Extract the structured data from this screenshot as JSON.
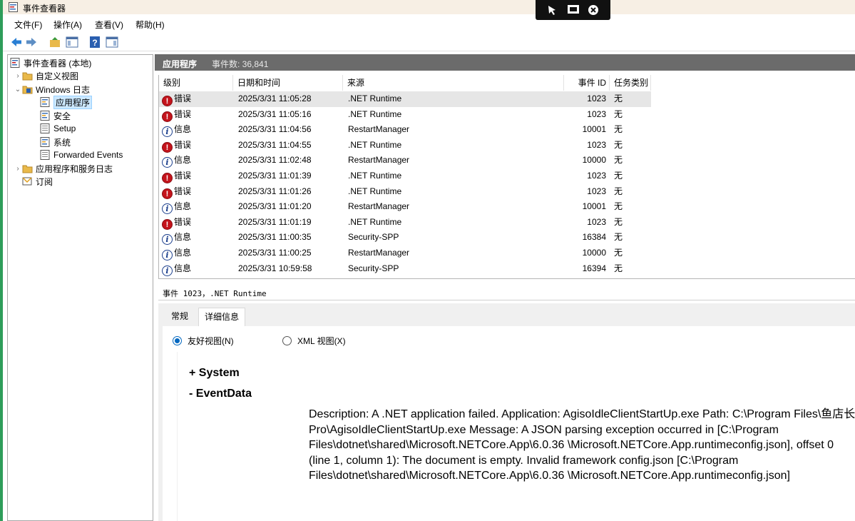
{
  "window": {
    "title": "事件查看器"
  },
  "menu": [
    "文件(F)",
    "操作(A)",
    "查看(V)",
    "帮助(H)"
  ],
  "toolbar": {
    "icons": [
      "back-arrow-icon",
      "forward-arrow-icon",
      "folder-up-icon",
      "show-hide-pane-icon",
      "help-icon",
      "action-pane-icon"
    ]
  },
  "tree": {
    "root": "事件查看器 (本地)",
    "custom_views": "自定义视图",
    "windows_logs": "Windows 日志",
    "application": "应用程序",
    "security": "安全",
    "setup": "Setup",
    "system": "系统",
    "forwarded": "Forwarded Events",
    "app_service_logs": "应用程序和服务日志",
    "subscriptions": "订阅"
  },
  "log_header": {
    "title": "应用程序",
    "count": "事件数: 36,841"
  },
  "columns": [
    "级别",
    "日期和时间",
    "来源",
    "事件 ID",
    "任务类别"
  ],
  "events": [
    {
      "level": "错误",
      "type": "err",
      "date": "2025/3/31 11:05:28",
      "source": ".NET Runtime",
      "id": "1023",
      "category": "无"
    },
    {
      "level": "错误",
      "type": "err",
      "date": "2025/3/31 11:05:16",
      "source": ".NET Runtime",
      "id": "1023",
      "category": "无"
    },
    {
      "level": "信息",
      "type": "info",
      "date": "2025/3/31 11:04:56",
      "source": "RestartManager",
      "id": "10001",
      "category": "无"
    },
    {
      "level": "错误",
      "type": "err",
      "date": "2025/3/31 11:04:55",
      "source": ".NET Runtime",
      "id": "1023",
      "category": "无"
    },
    {
      "level": "信息",
      "type": "info",
      "date": "2025/3/31 11:02:48",
      "source": "RestartManager",
      "id": "10000",
      "category": "无"
    },
    {
      "level": "错误",
      "type": "err",
      "date": "2025/3/31 11:01:39",
      "source": ".NET Runtime",
      "id": "1023",
      "category": "无"
    },
    {
      "level": "错误",
      "type": "err",
      "date": "2025/3/31 11:01:26",
      "source": ".NET Runtime",
      "id": "1023",
      "category": "无"
    },
    {
      "level": "信息",
      "type": "info",
      "date": "2025/3/31 11:01:20",
      "source": "RestartManager",
      "id": "10001",
      "category": "无"
    },
    {
      "level": "错误",
      "type": "err",
      "date": "2025/3/31 11:01:19",
      "source": ".NET Runtime",
      "id": "1023",
      "category": "无"
    },
    {
      "level": "信息",
      "type": "info",
      "date": "2025/3/31 11:00:35",
      "source": "Security-SPP",
      "id": "16384",
      "category": "无"
    },
    {
      "level": "信息",
      "type": "info",
      "date": "2025/3/31 11:00:25",
      "source": "RestartManager",
      "id": "10000",
      "category": "无"
    },
    {
      "level": "信息",
      "type": "info",
      "date": "2025/3/31 10:59:58",
      "source": "Security-SPP",
      "id": "16394",
      "category": "无"
    }
  ],
  "detail": {
    "heading": "事件 1023，.NET Runtime",
    "tabs": [
      "常规",
      "详细信息"
    ],
    "radio_friendly": "友好视图(N)",
    "radio_xml": "XML 视图(X)",
    "node_system": "+  System",
    "node_eventdata": "-  EventData",
    "description": "Description: A .NET application failed. Application: AgisoIdleClientStartUp.exe Path: C:\\Program Files\\鱼店长Pro\\AgisoIdleClientStartUp.exe Message: A JSON parsing exception occurred in [C:\\Program Files\\dotnet\\shared\\Microsoft.NETCore.App\\6.0.36 \\Microsoft.NETCore.App.runtimeconfig.json], offset 0 (line 1, column 1): The document is empty. Invalid framework config.json [C:\\Program Files\\dotnet\\shared\\Microsoft.NETCore.App\\6.0.36 \\Microsoft.NETCore.App.runtimeconfig.json]"
  },
  "colors": {
    "selection": "#cce8ff",
    "error": "#c4141c",
    "info": "#1a3e8c",
    "header_bar": "#6b6b6b",
    "accent_border": "#2e9d5a"
  }
}
